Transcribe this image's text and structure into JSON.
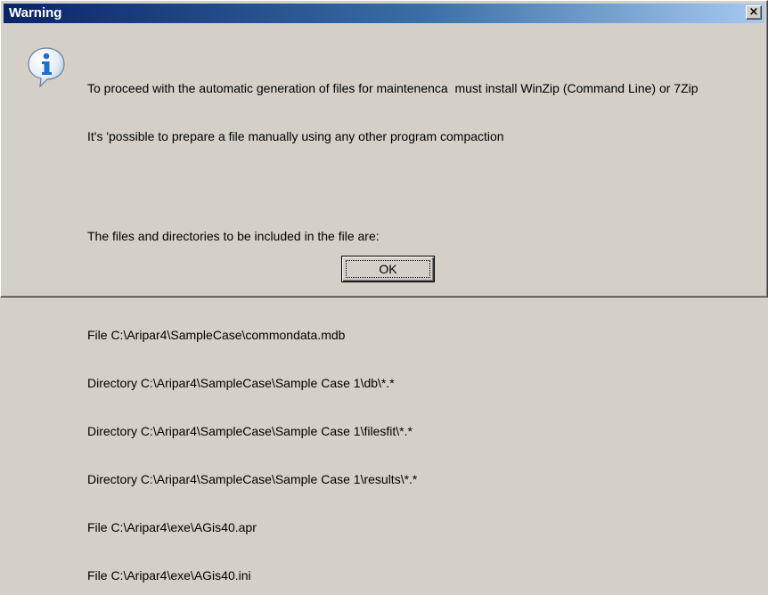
{
  "window": {
    "title": "Warning",
    "close_glyph": "×"
  },
  "icon": {
    "name": "information-icon",
    "glyph": "i",
    "color": "#1f6fd1"
  },
  "message": {
    "line1": "To proceed with the automatic generation of files for maintenenca  must install WinZip (Command Line) or 7Zip",
    "line2": "It's 'possible to prepare a file manually using any other program compaction",
    "line3": "The files and directories to be included in the file are:",
    "files": [
      "File C:\\Aripar4\\SampleCase\\commondata.mdb",
      "Directory C:\\Aripar4\\SampleCase\\Sample Case 1\\db\\*.*",
      "Directory C:\\Aripar4\\SampleCase\\Sample Case 1\\filesfit\\*.*",
      "Directory C:\\Aripar4\\SampleCase\\Sample Case 1\\results\\*.*",
      "File C:\\Aripar4\\exe\\AGis40.apr",
      "File C:\\Aripar4\\exe\\AGis40.ini"
    ]
  },
  "buttons": {
    "ok_label": "OK"
  },
  "colors": {
    "dialog_bg": "#d4d0c8",
    "title_start": "#0a246a",
    "title_end": "#a6caf0"
  }
}
